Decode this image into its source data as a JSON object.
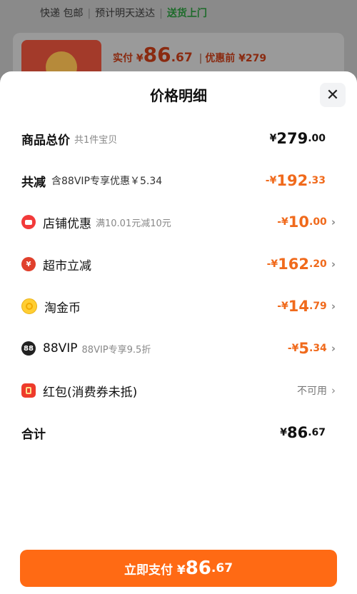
{
  "background": {
    "shipping": [
      "快递 包邮",
      "预计明天送达",
      "送货上门"
    ],
    "paid_label": "实付",
    "paid_currency": "¥",
    "paid_int": "86",
    "paid_dec": ".67",
    "before_label": "优惠前 ¥279"
  },
  "sheet": {
    "title": "价格明细",
    "close": "✕"
  },
  "rows": {
    "total": {
      "label": "商品总价",
      "sub": "共1件宝贝",
      "cur": "¥",
      "int": "279",
      "dec": ".00"
    },
    "reduce": {
      "label": "共减",
      "sub": "含88VIP专享优惠￥5.34",
      "cur": "-¥",
      "int": "192",
      "dec": ".33"
    },
    "shop": {
      "label": "店铺优惠",
      "sub": "满10.01元减10元",
      "cur": "-¥",
      "int": "10",
      "dec": ".00"
    },
    "market": {
      "label": "超市立减",
      "cur": "-¥",
      "int": "162",
      "dec": ".20"
    },
    "coin": {
      "label": "淘金币",
      "cur": "-¥",
      "int": "14",
      "dec": ".79"
    },
    "vip": {
      "label": "88VIP",
      "sub": "88VIP专享9.5折",
      "cur": "-¥",
      "int": "5",
      "dec": ".34",
      "badge": "88"
    },
    "redpack": {
      "label": "红包(消费券未抵)",
      "status": "不可用"
    },
    "sum": {
      "label": "合计",
      "cur": "¥",
      "int": "86",
      "dec": ".67"
    }
  },
  "pay": {
    "label": "立即支付 ¥",
    "int": "86",
    "dec": ".67"
  },
  "colors": {
    "accent": "#ff6a14",
    "discount": "#f06a1c"
  }
}
